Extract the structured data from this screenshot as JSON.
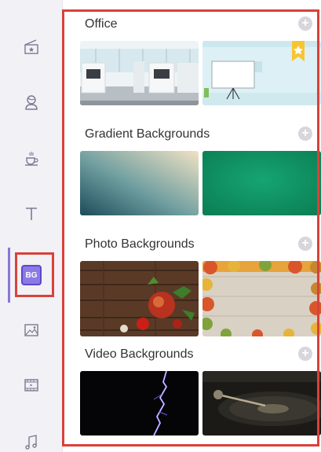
{
  "sidebar": {
    "items": [
      {
        "name": "scene-icon"
      },
      {
        "name": "character-icon"
      },
      {
        "name": "props-icon"
      },
      {
        "name": "text-icon",
        "glyph": "T"
      },
      {
        "name": "backgrounds-icon",
        "label": "BG",
        "active": true
      },
      {
        "name": "image-icon"
      },
      {
        "name": "video-icon"
      },
      {
        "name": "music-icon"
      }
    ],
    "accent": "#8b7ae6"
  },
  "sections": [
    {
      "title": "Office",
      "add": "+",
      "thumbs": [
        "office-room",
        "office-whiteboard"
      ]
    },
    {
      "title": "Gradient Backgrounds",
      "add": "+",
      "thumbs": [
        "gradient-teal",
        "gradient-green"
      ]
    },
    {
      "title": "Photo Backgrounds",
      "add": "+",
      "thumbs": [
        "photo-food-wood",
        "photo-leaves-frame"
      ]
    },
    {
      "title": "Video Backgrounds",
      "add": "+",
      "thumbs": [
        "video-lightning",
        "video-turntable"
      ]
    }
  ],
  "highlight_color": "#d9413a"
}
